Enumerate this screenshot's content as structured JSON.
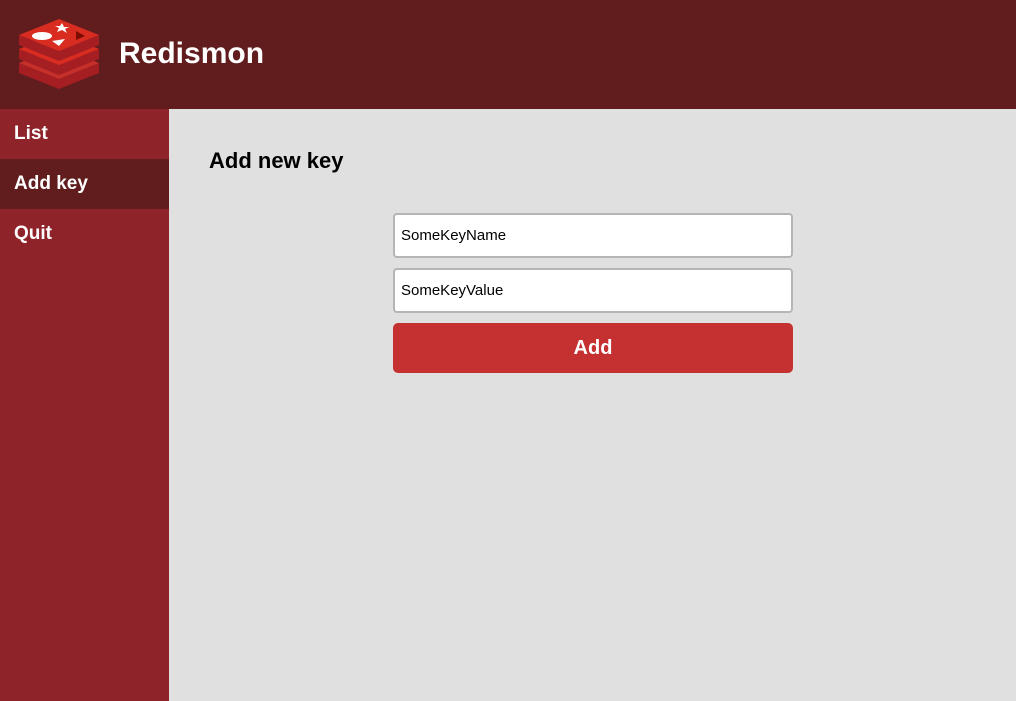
{
  "header": {
    "app_title": "Redismon",
    "logo_icon": "redis-logo-icon",
    "background_color": "#611c1e"
  },
  "sidebar": {
    "background_color": "#8e2429",
    "items": [
      {
        "label": "List",
        "active": false
      },
      {
        "label": "Add key",
        "active": true
      },
      {
        "label": "Quit",
        "active": false
      }
    ]
  },
  "main": {
    "page_title": "Add new key",
    "form": {
      "key_name_value": "SomeKeyName",
      "key_value_value": "SomeKeyValue",
      "submit_label": "Add",
      "submit_color": "#c53030"
    }
  }
}
